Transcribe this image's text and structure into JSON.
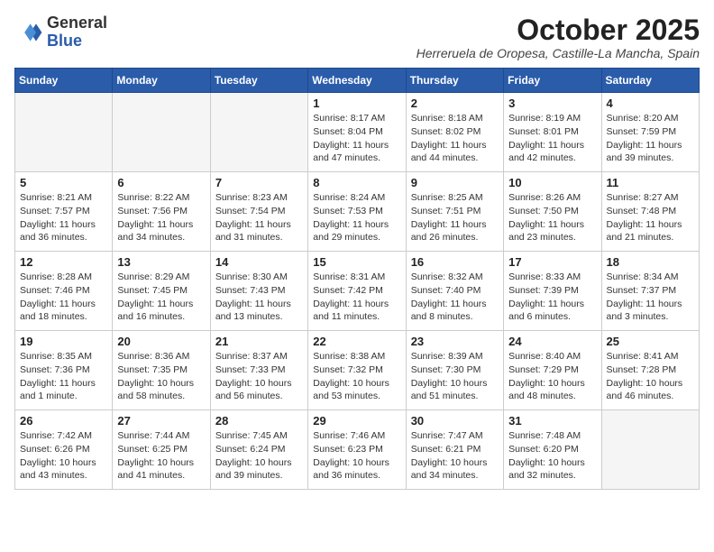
{
  "logo": {
    "general": "General",
    "blue": "Blue"
  },
  "header": {
    "month": "October 2025",
    "location": "Herreruela de Oropesa, Castille-La Mancha, Spain"
  },
  "days_of_week": [
    "Sunday",
    "Monday",
    "Tuesday",
    "Wednesday",
    "Thursday",
    "Friday",
    "Saturday"
  ],
  "weeks": [
    [
      {
        "day": "",
        "info": ""
      },
      {
        "day": "",
        "info": ""
      },
      {
        "day": "",
        "info": ""
      },
      {
        "day": "1",
        "info": "Sunrise: 8:17 AM\nSunset: 8:04 PM\nDaylight: 11 hours and 47 minutes."
      },
      {
        "day": "2",
        "info": "Sunrise: 8:18 AM\nSunset: 8:02 PM\nDaylight: 11 hours and 44 minutes."
      },
      {
        "day": "3",
        "info": "Sunrise: 8:19 AM\nSunset: 8:01 PM\nDaylight: 11 hours and 42 minutes."
      },
      {
        "day": "4",
        "info": "Sunrise: 8:20 AM\nSunset: 7:59 PM\nDaylight: 11 hours and 39 minutes."
      }
    ],
    [
      {
        "day": "5",
        "info": "Sunrise: 8:21 AM\nSunset: 7:57 PM\nDaylight: 11 hours and 36 minutes."
      },
      {
        "day": "6",
        "info": "Sunrise: 8:22 AM\nSunset: 7:56 PM\nDaylight: 11 hours and 34 minutes."
      },
      {
        "day": "7",
        "info": "Sunrise: 8:23 AM\nSunset: 7:54 PM\nDaylight: 11 hours and 31 minutes."
      },
      {
        "day": "8",
        "info": "Sunrise: 8:24 AM\nSunset: 7:53 PM\nDaylight: 11 hours and 29 minutes."
      },
      {
        "day": "9",
        "info": "Sunrise: 8:25 AM\nSunset: 7:51 PM\nDaylight: 11 hours and 26 minutes."
      },
      {
        "day": "10",
        "info": "Sunrise: 8:26 AM\nSunset: 7:50 PM\nDaylight: 11 hours and 23 minutes."
      },
      {
        "day": "11",
        "info": "Sunrise: 8:27 AM\nSunset: 7:48 PM\nDaylight: 11 hours and 21 minutes."
      }
    ],
    [
      {
        "day": "12",
        "info": "Sunrise: 8:28 AM\nSunset: 7:46 PM\nDaylight: 11 hours and 18 minutes."
      },
      {
        "day": "13",
        "info": "Sunrise: 8:29 AM\nSunset: 7:45 PM\nDaylight: 11 hours and 16 minutes."
      },
      {
        "day": "14",
        "info": "Sunrise: 8:30 AM\nSunset: 7:43 PM\nDaylight: 11 hours and 13 minutes."
      },
      {
        "day": "15",
        "info": "Sunrise: 8:31 AM\nSunset: 7:42 PM\nDaylight: 11 hours and 11 minutes."
      },
      {
        "day": "16",
        "info": "Sunrise: 8:32 AM\nSunset: 7:40 PM\nDaylight: 11 hours and 8 minutes."
      },
      {
        "day": "17",
        "info": "Sunrise: 8:33 AM\nSunset: 7:39 PM\nDaylight: 11 hours and 6 minutes."
      },
      {
        "day": "18",
        "info": "Sunrise: 8:34 AM\nSunset: 7:37 PM\nDaylight: 11 hours and 3 minutes."
      }
    ],
    [
      {
        "day": "19",
        "info": "Sunrise: 8:35 AM\nSunset: 7:36 PM\nDaylight: 11 hours and 1 minute."
      },
      {
        "day": "20",
        "info": "Sunrise: 8:36 AM\nSunset: 7:35 PM\nDaylight: 10 hours and 58 minutes."
      },
      {
        "day": "21",
        "info": "Sunrise: 8:37 AM\nSunset: 7:33 PM\nDaylight: 10 hours and 56 minutes."
      },
      {
        "day": "22",
        "info": "Sunrise: 8:38 AM\nSunset: 7:32 PM\nDaylight: 10 hours and 53 minutes."
      },
      {
        "day": "23",
        "info": "Sunrise: 8:39 AM\nSunset: 7:30 PM\nDaylight: 10 hours and 51 minutes."
      },
      {
        "day": "24",
        "info": "Sunrise: 8:40 AM\nSunset: 7:29 PM\nDaylight: 10 hours and 48 minutes."
      },
      {
        "day": "25",
        "info": "Sunrise: 8:41 AM\nSunset: 7:28 PM\nDaylight: 10 hours and 46 minutes."
      }
    ],
    [
      {
        "day": "26",
        "info": "Sunrise: 7:42 AM\nSunset: 6:26 PM\nDaylight: 10 hours and 43 minutes."
      },
      {
        "day": "27",
        "info": "Sunrise: 7:44 AM\nSunset: 6:25 PM\nDaylight: 10 hours and 41 minutes."
      },
      {
        "day": "28",
        "info": "Sunrise: 7:45 AM\nSunset: 6:24 PM\nDaylight: 10 hours and 39 minutes."
      },
      {
        "day": "29",
        "info": "Sunrise: 7:46 AM\nSunset: 6:23 PM\nDaylight: 10 hours and 36 minutes."
      },
      {
        "day": "30",
        "info": "Sunrise: 7:47 AM\nSunset: 6:21 PM\nDaylight: 10 hours and 34 minutes."
      },
      {
        "day": "31",
        "info": "Sunrise: 7:48 AM\nSunset: 6:20 PM\nDaylight: 10 hours and 32 minutes."
      },
      {
        "day": "",
        "info": ""
      }
    ]
  ]
}
